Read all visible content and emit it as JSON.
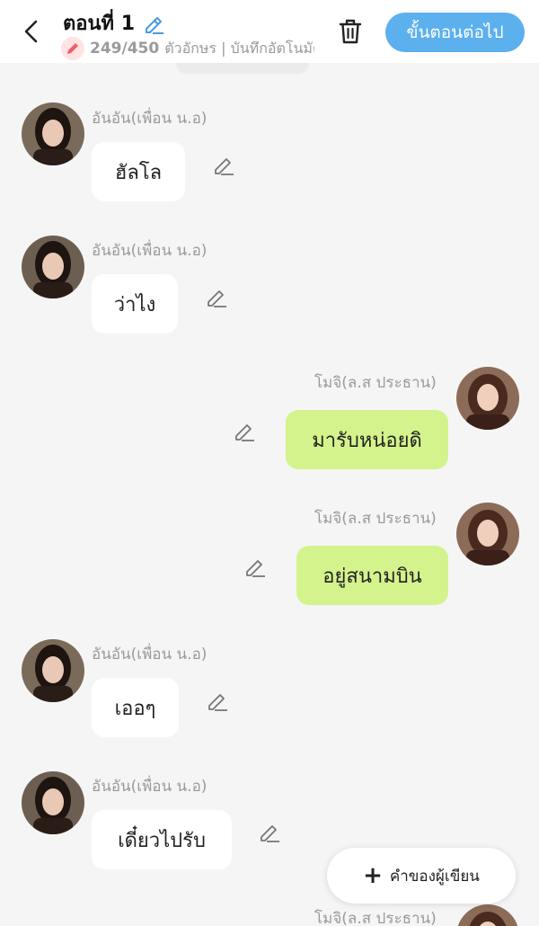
{
  "header": {
    "title": "ตอนที่ 1",
    "char_count": "249/450",
    "subtitle": "ตัวอักษร | บันทึกอัตโนมัติ",
    "next_label": "ขั้นตอนต่อไป"
  },
  "messages": [
    {
      "name": "อันอัน(เพื่อน น.อ)",
      "text": "ฮัลโล",
      "side": "left"
    },
    {
      "name": "อันอัน(เพื่อน น.อ)",
      "text": "ว่าไง",
      "side": "left"
    },
    {
      "name": "โมจิ(ล.ส ประธาน)",
      "text": "มารับหน่อยดิ",
      "side": "right"
    },
    {
      "name": "โมจิ(ล.ส ประธาน)",
      "text": "อยู่สนามบิน",
      "side": "right"
    },
    {
      "name": "อันอัน(เพื่อน น.อ)",
      "text": "เออๆ",
      "side": "left"
    },
    {
      "name": "อันอัน(เพื่อน น.อ)",
      "text": "เดี๋ยวไปรับ",
      "side": "left"
    },
    {
      "name": "โมจิ(ล.ส ประธาน)",
      "text": "",
      "side": "right"
    }
  ],
  "fab": {
    "label": "คำของผู้เขียน"
  },
  "colors": {
    "accent": "#5cb0ee",
    "my_bubble": "#d4f38c",
    "other_bubble": "#ffffff",
    "background": "#f5f5f5"
  },
  "icons": [
    "back-icon",
    "edit-icon",
    "pencil-icon",
    "trash-icon",
    "plus-icon"
  ]
}
